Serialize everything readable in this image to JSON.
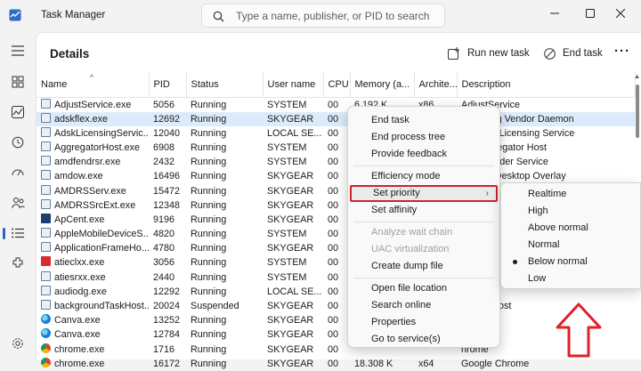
{
  "app": {
    "title": "Task Manager",
    "search_placeholder": "Type a name, publisher, or PID to search"
  },
  "page": {
    "title": "Details"
  },
  "toolbar": {
    "run_new_task": "Run new task",
    "end_task": "End task",
    "more": "···"
  },
  "sidebar": {
    "items": [
      {
        "icon": "hamburger-menu-icon"
      },
      {
        "icon": "processes-icon"
      },
      {
        "icon": "performance-icon"
      },
      {
        "icon": "app-history-icon"
      },
      {
        "icon": "startup-apps-icon"
      },
      {
        "icon": "users-icon"
      },
      {
        "icon": "details-icon",
        "active": true
      },
      {
        "icon": "services-icon"
      },
      {
        "icon": "settings-icon"
      }
    ]
  },
  "columns": [
    "Name",
    "PID",
    "Status",
    "User name",
    "CPU",
    "Memory (a...",
    "Archite...",
    "Description"
  ],
  "rows": [
    {
      "name": "AdjustService.exe",
      "pid": "5056",
      "status": "Running",
      "user": "SYSTEM",
      "cpu": "00",
      "mem": "6.192 K",
      "arch": "x86",
      "desc": "AdjustService",
      "icon": "app"
    },
    {
      "name": "adskflex.exe",
      "pid": "12692",
      "status": "Running",
      "user": "SKYGEAR",
      "cpu": "00",
      "mem": "",
      "arch": "",
      "desc": "Licensing Vendor Daemon",
      "icon": "app",
      "selected": true
    },
    {
      "name": "AdskLicensingServic...",
      "pid": "12040",
      "status": "Running",
      "user": "LOCAL SE...",
      "cpu": "00",
      "mem": "",
      "arch": "",
      "desc": "Desktop Licensing Service",
      "icon": "app"
    },
    {
      "name": "AggregatorHost.exe",
      "pid": "6908",
      "status": "Running",
      "user": "SYSTEM",
      "cpu": "00",
      "mem": "",
      "arch": "",
      "desc": "(R) Aggregator Host",
      "icon": "app"
    },
    {
      "name": "amdfendrsr.exe",
      "pid": "2432",
      "status": "Running",
      "user": "SYSTEM",
      "cpu": "00",
      "mem": "",
      "arch": "",
      "desc": "sh Defender Service",
      "icon": "app"
    },
    {
      "name": "amdow.exe",
      "pid": "16496",
      "status": "Running",
      "user": "SKYGEAR",
      "cpu": "00",
      "mem": "",
      "arch": "",
      "desc": "ettings: Desktop Overlay",
      "icon": "app"
    },
    {
      "name": "AMDRSServ.exe",
      "pid": "15472",
      "status": "Running",
      "user": "SKYGEAR",
      "cpu": "00",
      "mem": "",
      "arch": "",
      "desc": "",
      "icon": "app"
    },
    {
      "name": "AMDRSSrcExt.exe",
      "pid": "12348",
      "status": "Running",
      "user": "SKYGEAR",
      "cpu": "00",
      "mem": "",
      "arch": "",
      "desc": "",
      "icon": "app"
    },
    {
      "name": "ApCent.exe",
      "pid": "9196",
      "status": "Running",
      "user": "SKYGEAR",
      "cpu": "00",
      "mem": "",
      "arch": "",
      "desc": "",
      "icon": "cent"
    },
    {
      "name": "AppleMobileDeviceS...",
      "pid": "4820",
      "status": "Running",
      "user": "SYSTEM",
      "cpu": "00",
      "mem": "",
      "arch": "",
      "desc": "",
      "icon": "app"
    },
    {
      "name": "ApplicationFrameHo...",
      "pid": "4780",
      "status": "Running",
      "user": "SKYGEAR",
      "cpu": "00",
      "mem": "",
      "arch": "",
      "desc": "",
      "icon": "app"
    },
    {
      "name": "atieclxx.exe",
      "pid": "3056",
      "status": "Running",
      "user": "SYSTEM",
      "cpu": "00",
      "mem": "",
      "arch": "",
      "desc": "",
      "icon": "red"
    },
    {
      "name": "atiesrxx.exe",
      "pid": "2440",
      "status": "Running",
      "user": "SYSTEM",
      "cpu": "00",
      "mem": "",
      "arch": "",
      "desc": "",
      "icon": "app"
    },
    {
      "name": "audiodg.exe",
      "pid": "12292",
      "status": "Running",
      "user": "LOCAL SE...",
      "cpu": "00",
      "mem": "",
      "arch": "",
      "desc": "",
      "icon": "app"
    },
    {
      "name": "backgroundTaskHost...",
      "pid": "20024",
      "status": "Suspended",
      "user": "SKYGEAR",
      "cpu": "00",
      "mem": "",
      "arch": "",
      "desc": "ndTaskHost",
      "icon": "app"
    },
    {
      "name": "Canva.exe",
      "pid": "13252",
      "status": "Running",
      "user": "SKYGEAR",
      "cpu": "00",
      "mem": "",
      "arch": "",
      "desc": "",
      "icon": "edge"
    },
    {
      "name": "Canva.exe",
      "pid": "12784",
      "status": "Running",
      "user": "SKYGEAR",
      "cpu": "00",
      "mem": "",
      "arch": "",
      "desc": "",
      "icon": "edge"
    },
    {
      "name": "chrome.exe",
      "pid": "1716",
      "status": "Running",
      "user": "SKYGEAR",
      "cpu": "00",
      "mem": "",
      "arch": "",
      "desc": "hrome",
      "icon": "chrome"
    },
    {
      "name": "chrome.exe",
      "pid": "16172",
      "status": "Running",
      "user": "SKYGEAR",
      "cpu": "00",
      "mem": "18.308 K",
      "arch": "x64",
      "desc": "Google Chrome",
      "icon": "chrome"
    }
  ],
  "context_menu": {
    "items": [
      {
        "label": "End task",
        "disabled": false
      },
      {
        "label": "End process tree",
        "disabled": false
      },
      {
        "label": "Provide feedback",
        "disabled": false
      },
      {
        "label": "Efficiency mode",
        "disabled": false
      },
      {
        "label": "Set priority",
        "disabled": false,
        "submenu": true,
        "highlighted": true
      },
      {
        "label": "Set affinity",
        "disabled": false
      },
      {
        "label": "Analyze wait chain",
        "disabled": true
      },
      {
        "label": "UAC virtualization",
        "disabled": true
      },
      {
        "label": "Create dump file",
        "disabled": false
      },
      {
        "label": "Open file location",
        "disabled": false
      },
      {
        "label": "Search online",
        "disabled": false
      },
      {
        "label": "Properties",
        "disabled": false
      },
      {
        "label": "Go to service(s)",
        "disabled": false
      }
    ]
  },
  "priority_submenu": {
    "items": [
      {
        "label": "Realtime",
        "selected": false
      },
      {
        "label": "High",
        "selected": false
      },
      {
        "label": "Above normal",
        "selected": false
      },
      {
        "label": "Normal",
        "selected": false
      },
      {
        "label": "Below normal",
        "selected": true
      },
      {
        "label": "Low",
        "selected": false
      }
    ]
  },
  "colors": {
    "highlight_border": "#d2202f",
    "annotation_arrow": "#e0202a",
    "accent": "#2f63c0"
  }
}
